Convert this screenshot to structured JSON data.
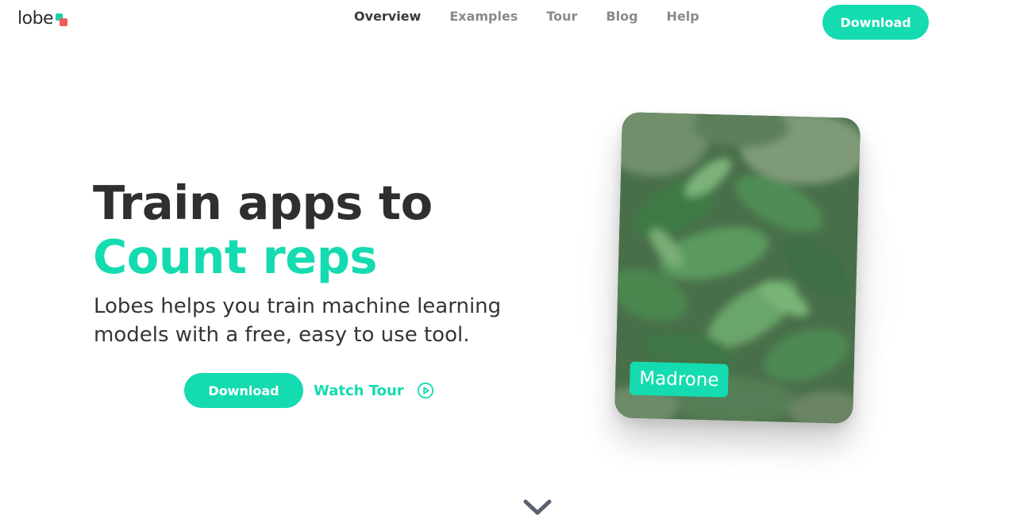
{
  "header": {
    "logo_text": "lobe",
    "nav": [
      {
        "label": "Overview",
        "active": true
      },
      {
        "label": "Examples",
        "active": false
      },
      {
        "label": "Tour",
        "active": false
      },
      {
        "label": "Blog",
        "active": false
      },
      {
        "label": "Help",
        "active": false
      }
    ],
    "download_label": "Download"
  },
  "hero": {
    "headline": "Train apps to",
    "highlight": "Count reps",
    "subtext": "Lobes helps you train machine learning models with a free, easy to use tool.",
    "download_label": "Download",
    "watch_tour_label": "Watch Tour"
  },
  "card": {
    "label": "Madrone"
  },
  "icons": {
    "logo": "lobe-logo-mark",
    "play": "play-circle-icon",
    "scroll": "chevron-down-icon"
  },
  "colors": {
    "accent": "#15dbb0",
    "logo_red": "#f25a5a",
    "text_dark": "#2f2f2f",
    "nav_inactive": "#8a8a8a",
    "chevron": "#5a6270"
  }
}
